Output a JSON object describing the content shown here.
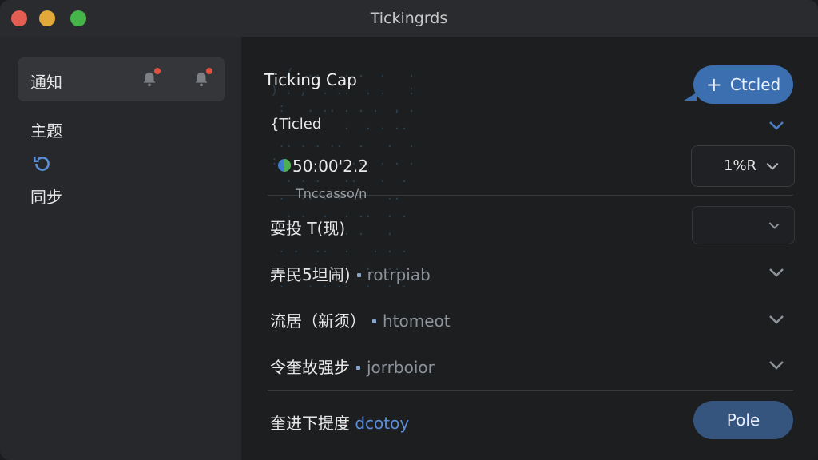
{
  "window": {
    "title": "Tickingrds"
  },
  "sidebar": {
    "items": [
      {
        "label": "通知"
      },
      {
        "label": "主题"
      },
      {
        "label": "同步"
      }
    ]
  },
  "main": {
    "heading": "Ticking Cap",
    "section_label": "{Ticled",
    "status_value": "50:00'2.2",
    "select_value": "1%R",
    "subsection_label": "Tnccasso/n",
    "rows": [
      {
        "label": "耍投 T(现)",
        "extra": ""
      },
      {
        "label": "弄民5坦闹)",
        "extra": "rotrpiab"
      },
      {
        "label": "流居（新须）",
        "extra": "htomeot"
      },
      {
        "label": "令奎故强步",
        "extra": "jorrboior"
      },
      {
        "label": "奎进下提度",
        "extra": "dcotoy"
      }
    ],
    "primary_button": "Ctcled",
    "pole_button": "Pole"
  },
  "colors": {
    "accent": "#3b6fb0",
    "notification_dot": "#e0523f",
    "window_bg": "#202124"
  }
}
